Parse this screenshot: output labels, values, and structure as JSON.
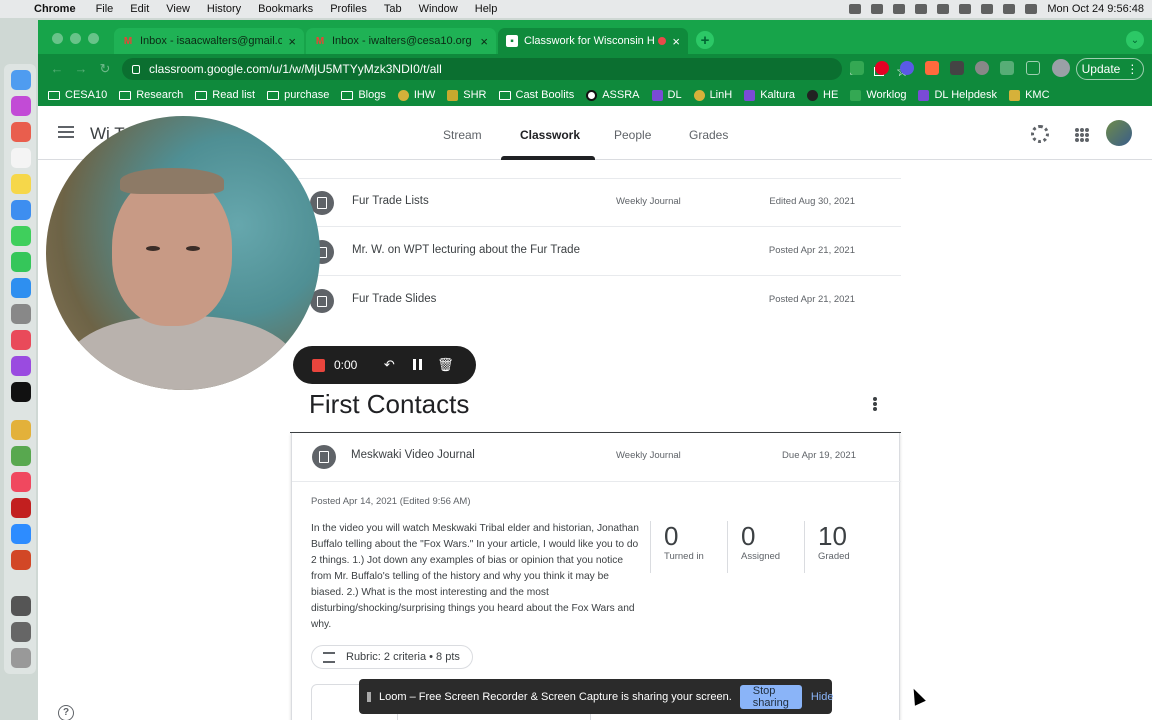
{
  "menubar": {
    "app": "Chrome",
    "items": [
      "File",
      "Edit",
      "View",
      "History",
      "Bookmarks",
      "Profiles",
      "Tab",
      "Window",
      "Help"
    ],
    "clock": "Mon Oct 24  9:56:48"
  },
  "tabs": [
    {
      "title": "Inbox - isaacwalters@gmail.com",
      "favicon": "gmail-icon"
    },
    {
      "title": "Inbox - iwalters@cesa10.org -",
      "favicon": "gmail-icon"
    },
    {
      "title": "Classwork for Wisconsin H",
      "favicon": "classroom-icon"
    }
  ],
  "address": {
    "url": "classroom.google.com/u/1/w/MjU5MTYyMzk3NDI0/t/all"
  },
  "update_label": "Update",
  "bookmarks": [
    "CESA10",
    "Research",
    "Read list",
    "purchase",
    "Blogs",
    "IHW",
    "SHR",
    "Cast Boolits",
    "ASSRA",
    "DL",
    "LinH",
    "Kaltura",
    "HE",
    "Worklog",
    "DL Helpdesk",
    "KMC"
  ],
  "classroom": {
    "class_title": "Wi         Tri 3 2021",
    "tabs": [
      "Stream",
      "Classwork",
      "People",
      "Grades"
    ]
  },
  "items": [
    {
      "title": "Fur Trade Lists",
      "type": "Weekly Journal",
      "date": "Edited Aug 30, 2021",
      "icon": "assignment-icon"
    },
    {
      "title": "Mr. W. on WPT lecturing about the Fur Trade",
      "type": "",
      "date": "Posted Apr 21, 2021",
      "icon": "material-icon"
    },
    {
      "title": "Fur Trade Slides",
      "type": "",
      "date": "Posted Apr 21, 2021",
      "icon": "material-icon"
    }
  ],
  "topic": {
    "title": "First Contacts"
  },
  "expanded": {
    "title": "Meskwaki Video Journal",
    "type": "Weekly Journal",
    "due": "Due Apr 19, 2021",
    "posted": "Posted Apr 14, 2021 (Edited 9:56 AM)",
    "description": "In the video you will watch Meskwaki Tribal elder and historian, Jonathan Buffalo telling about the \"Fox Wars.\"  In your article, I would like you to do 2 things.  1.) Jot down any examples of bias or opinion that you notice from Mr. Buffalo's telling of the history and why you think it may be biased.  2.)  What is the most interesting and the most disturbing/shocking/surprising things you heard about the Fox Wars and why.",
    "stats": [
      {
        "num": "0",
        "label": "Turned in"
      },
      {
        "num": "0",
        "label": "Assigned"
      },
      {
        "num": "10",
        "label": "Graded"
      }
    ],
    "rubric": "Rubric: 2 criteria • 8 pts"
  },
  "loom": {
    "timer": "0:00",
    "share_message": "Loom – Free Screen Recorder & Screen Capture is sharing your screen.",
    "stop_label": "Stop sharing",
    "hide_label": "Hide"
  },
  "colors": {
    "chrome_theme": "#0f8a3c",
    "loom_stop": "#8ab4f8",
    "record": "#e9453d"
  }
}
